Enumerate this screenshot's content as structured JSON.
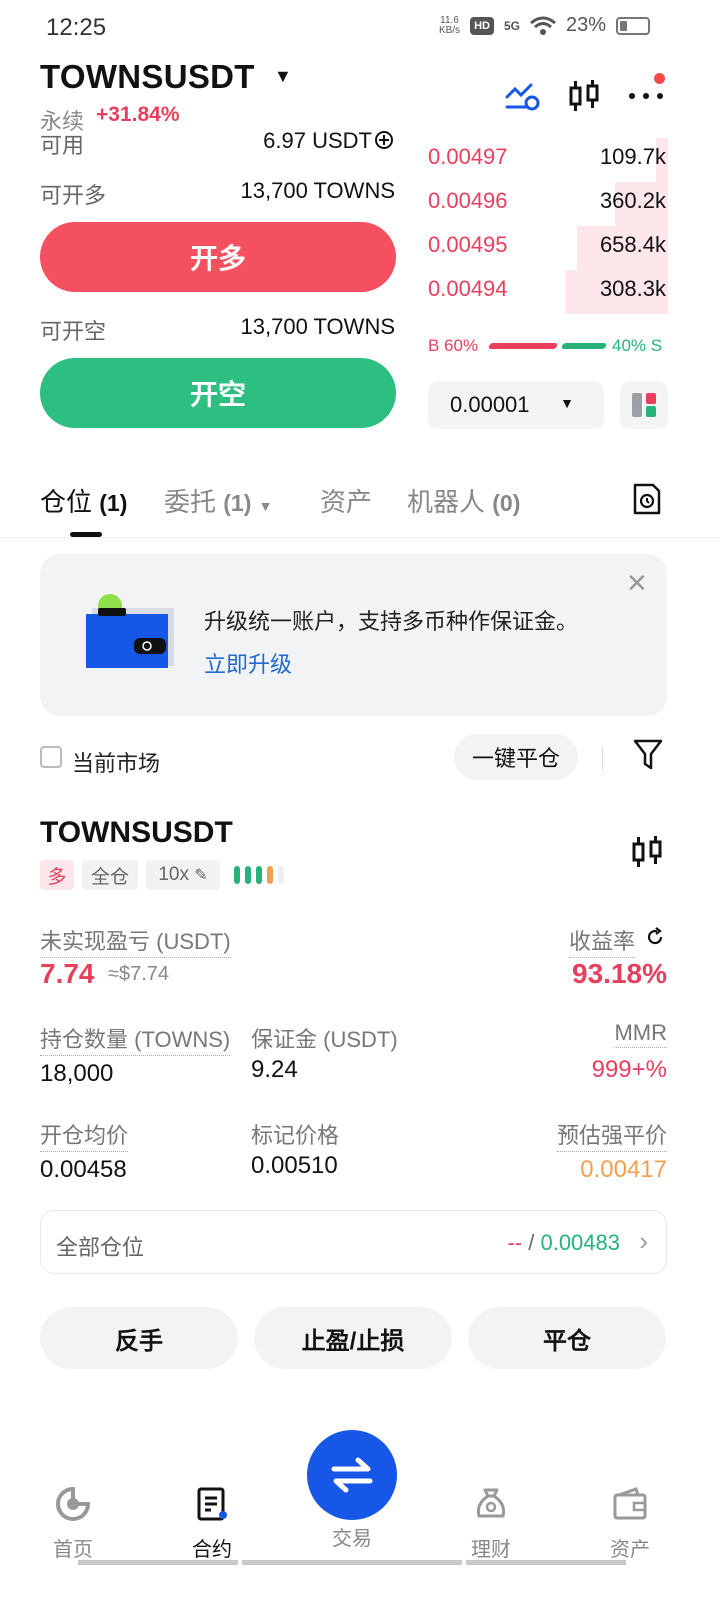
{
  "status_bar": {
    "time": "12:25",
    "net_speed_value": "11.6",
    "net_speed_unit": "KB/s",
    "hd": "HD",
    "signal": "5G",
    "battery": "23%"
  },
  "header": {
    "pair": "TOWNSUSDT",
    "caret": "▼",
    "perp_label": "永续",
    "change": "+31.84%"
  },
  "order_panel": {
    "available_label": "可用",
    "available_value": "6.97 USDT",
    "long_available_label": "可开多",
    "long_available_value": "13,700 TOWNS",
    "open_long_label": "开多",
    "short_available_label": "可开空",
    "short_available_value": "13,700 TOWNS",
    "open_short_label": "开空"
  },
  "orderbook": {
    "asks": [
      {
        "price": "0.00497",
        "size": "109.7k",
        "depth": 0.05
      },
      {
        "price": "0.00496",
        "size": "360.2k",
        "depth": 0.22
      },
      {
        "price": "0.00495",
        "size": "658.4k",
        "depth": 0.38
      },
      {
        "price": "0.00494",
        "size": "308.3k",
        "depth": 0.43
      }
    ],
    "buy_ratio": "B 60%",
    "sell_ratio": "40% S",
    "step": "0.00001"
  },
  "tabs": [
    {
      "label": "仓位",
      "count": "(1)"
    },
    {
      "label": "委托",
      "count": "(1)"
    },
    {
      "label": "资产",
      "count": ""
    },
    {
      "label": "机器人",
      "count": "(0)"
    }
  ],
  "banner": {
    "text": "升级统一账户，支持多币种作保证金。",
    "link": "立即升级"
  },
  "filter": {
    "current_market": "当前市场",
    "close_all": "一键平仓"
  },
  "position": {
    "symbol": "TOWNSUSDT",
    "side": "多",
    "margin_mode": "全仓",
    "leverage": "10x",
    "unrealized_pnl_label": "未实现盈亏 (USDT)",
    "unrealized_pnl": "7.74",
    "unrealized_pnl_usd": "≈$7.74",
    "roe_label": "收益率",
    "roe": "93.18%",
    "size_label": "持仓数量 (TOWNS)",
    "size": "18,000",
    "margin_label": "保证金 (USDT)",
    "margin": "9.24",
    "mmr_label": "MMR",
    "mmr": "999+%",
    "entry_label": "开仓均价",
    "entry": "0.00458",
    "mark_label": "标记价格",
    "mark": "0.00510",
    "liq_label": "预估强平价",
    "liq": "0.00417",
    "all_positions_label": "全部仓位",
    "all_positions_left": "--",
    "all_positions_sep": "/",
    "all_positions_right": "0.00483",
    "buttons": [
      "反手",
      "止盈/止损",
      "平仓"
    ]
  },
  "bottom_nav": [
    {
      "label": "首页"
    },
    {
      "label": "合约"
    },
    {
      "label": "交易"
    },
    {
      "label": "理财"
    },
    {
      "label": "资产"
    }
  ],
  "colors": {
    "red": "#e8405c",
    "green": "#26b37a",
    "blue": "#1657e8",
    "orange": "#f0a050"
  }
}
